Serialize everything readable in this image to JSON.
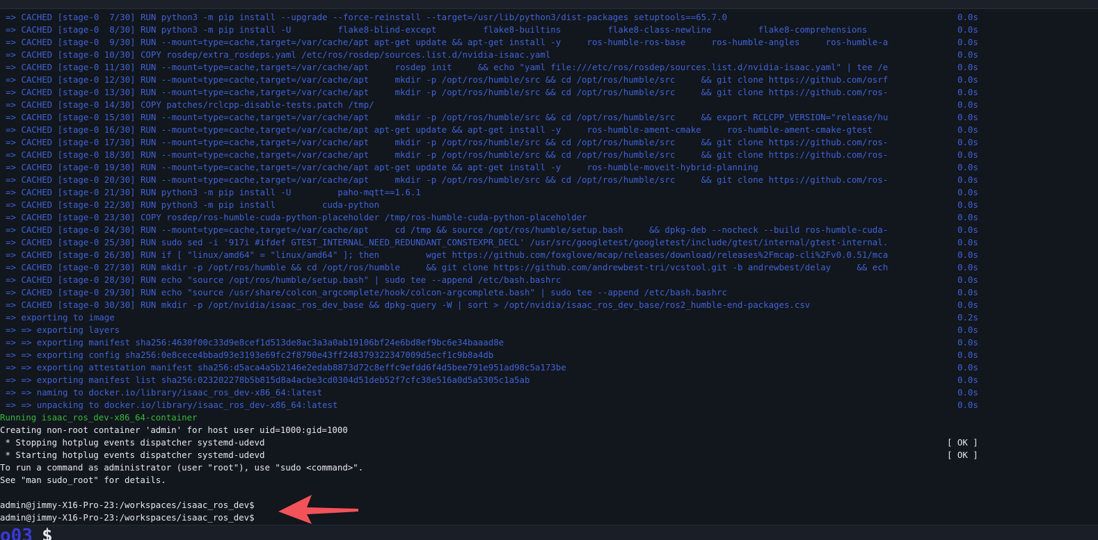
{
  "terminal": {
    "build_steps": [
      {
        "text": "=> CACHED [stage-0  7/30] RUN python3 -m pip install --upgrade --force-reinstall --target=/usr/lib/python3/dist-packages setuptools==65.7.0",
        "time": "0.0s"
      },
      {
        "text": "=> CACHED [stage-0  8/30] RUN python3 -m pip install -U         flake8-blind-except         flake8-builtins         flake8-class-newline         flake8-comprehensions",
        "time": "0.0s"
      },
      {
        "text": "=> CACHED [stage-0  9/30] RUN --mount=type=cache,target=/var/cache/apt apt-get update && apt-get install -y     ros-humble-ros-base     ros-humble-angles     ros-humble-a",
        "time": "0.0s"
      },
      {
        "text": "=> CACHED [stage-0 10/30] COPY rosdep/extra_rosdeps.yaml /etc/ros/rosdep/sources.list.d/nvidia-isaac.yaml",
        "time": "0.0s"
      },
      {
        "text": "=> CACHED [stage-0 11/30] RUN --mount=type=cache,target=/var/cache/apt     rosdep init     && echo \"yaml file:///etc/ros/rosdep/sources.list.d/nvidia-isaac.yaml\" | tee /e",
        "time": "0.0s"
      },
      {
        "text": "=> CACHED [stage-0 12/30] RUN --mount=type=cache,target=/var/cache/apt     mkdir -p /opt/ros/humble/src && cd /opt/ros/humble/src     && git clone https://github.com/osrf",
        "time": "0.0s"
      },
      {
        "text": "=> CACHED [stage-0 13/30] RUN --mount=type=cache,target=/var/cache/apt     mkdir -p /opt/ros/humble/src && cd /opt/ros/humble/src     && git clone https://github.com/ros-",
        "time": "0.0s"
      },
      {
        "text": "=> CACHED [stage-0 14/30] COPY patches/rclcpp-disable-tests.patch /tmp/",
        "time": "0.0s"
      },
      {
        "text": "=> CACHED [stage-0 15/30] RUN --mount=type=cache,target=/var/cache/apt     mkdir -p /opt/ros/humble/src && cd /opt/ros/humble/src     && export RCLCPP_VERSION=\"release/hu",
        "time": "0.0s"
      },
      {
        "text": "=> CACHED [stage-0 16/30] RUN --mount=type=cache,target=/var/cache/apt apt-get update && apt-get install -y     ros-humble-ament-cmake     ros-humble-ament-cmake-gtest",
        "time": "0.0s"
      },
      {
        "text": "=> CACHED [stage-0 17/30] RUN --mount=type=cache,target=/var/cache/apt     mkdir -p /opt/ros/humble/src && cd /opt/ros/humble/src     && git clone https://github.com/ros-",
        "time": "0.0s"
      },
      {
        "text": "=> CACHED [stage-0 18/30] RUN --mount=type=cache,target=/var/cache/apt     mkdir -p /opt/ros/humble/src && cd /opt/ros/humble/src     && git clone https://github.com/ros-",
        "time": "0.0s"
      },
      {
        "text": "=> CACHED [stage-0 19/30] RUN --mount=type=cache,target=/var/cache/apt apt-get update && apt-get install -y     ros-humble-moveit-hybrid-planning",
        "time": "0.0s"
      },
      {
        "text": "=> CACHED [stage-0 20/30] RUN --mount=type=cache,target=/var/cache/apt     mkdir -p /opt/ros/humble/src && cd /opt/ros/humble/src     && git clone https://github.com/ros-",
        "time": "0.0s"
      },
      {
        "text": "=> CACHED [stage-0 21/30] RUN python3 -m pip install -U         paho-mqtt==1.6.1",
        "time": "0.0s"
      },
      {
        "text": "=> CACHED [stage-0 22/30] RUN python3 -m pip install         cuda-python",
        "time": "0.0s"
      },
      {
        "text": "=> CACHED [stage-0 23/30] COPY rosdep/ros-humble-cuda-python-placeholder /tmp/ros-humble-cuda-python-placeholder",
        "time": "0.0s"
      },
      {
        "text": "=> CACHED [stage-0 24/30] RUN --mount=type=cache,target=/var/cache/apt     cd /tmp && source /opt/ros/humble/setup.bash     && dpkg-deb --nocheck --build ros-humble-cuda-",
        "time": "0.0s"
      },
      {
        "text": "=> CACHED [stage-0 25/30] RUN sudo sed -i '917i #ifdef GTEST_INTERNAL_NEED_REDUNDANT_CONSTEXPR_DECL' /usr/src/googletest/googletest/include/gtest/internal/gtest-internal.",
        "time": "0.0s"
      },
      {
        "text": "=> CACHED [stage-0 26/30] RUN if [ \"linux/amd64\" = \"linux/amd64\" ]; then         wget https://github.com/foxglove/mcap/releases/download/releases%2Fmcap-cli%2Fv0.0.51/mca",
        "time": "0.0s"
      },
      {
        "text": "=> CACHED [stage-0 27/30] RUN mkdir -p /opt/ros/humble && cd /opt/ros/humble     && git clone https://github.com/andrewbest-tri/vcstool.git -b andrewbest/delay     && ech",
        "time": "0.0s"
      },
      {
        "text": "=> CACHED [stage-0 28/30] RUN echo \"source /opt/ros/humble/setup.bash\" | sudo tee --append /etc/bash.bashrc",
        "time": "0.0s"
      },
      {
        "text": "=> CACHED [stage-0 29/30] RUN echo \"source /usr/share/colcon_argcomplete/hook/colcon-argcomplete.bash\" | sudo tee --append /etc/bash.bashrc",
        "time": "0.0s"
      },
      {
        "text": "=> CACHED [stage-0 30/30] RUN mkdir -p /opt/nvidia/isaac_ros_dev_base && dpkg-query -W | sort > /opt/nvidia/isaac_ros_dev_base/ros2_humble-end-packages.csv",
        "time": "0.0s"
      },
      {
        "text": "=> exporting to image",
        "time": "0.2s"
      },
      {
        "text": "=> => exporting layers",
        "time": "0.0s"
      },
      {
        "text": "=> => exporting manifest sha256:4630f00c33d9e8cef1d513de8ac3a3a0ab19106bf24e6bd8ef9bc6e34baaad8e",
        "time": "0.0s"
      },
      {
        "text": "=> => exporting config sha256:0e8cece4bbad93e3193e69fc2f8790e43ff248379322347009d5ecf1c9b8a4db",
        "time": "0.0s"
      },
      {
        "text": "=> => exporting attestation manifest sha256:d5aca4a5b2146e2edab8873d72c8effc9efdd6f4d5bee791e951ad98c5a173be",
        "time": "0.0s"
      },
      {
        "text": "=> => exporting manifest list sha256:023202278b5b815d8a4acbe3cd0304d51deb52f7cfc38e516a0d5a5305c1a5ab",
        "time": "0.0s"
      },
      {
        "text": "=> => naming to docker.io/library/isaac_ros_dev-x86_64:latest",
        "time": "0.0s"
      },
      {
        "text": "=> => unpacking to docker.io/library/isaac_ros_dev-x86_64:latest",
        "time": "0.0s"
      }
    ],
    "running_line": "Running isaac_ros_dev-x86_64-container",
    "creating_line": "Creating non-root container 'admin' for host user uid=1000:gid=1000",
    "service_lines": [
      {
        "text": " * Stopping hotplug events dispatcher systemd-udevd",
        "status": "[ OK ]"
      },
      {
        "text": " * Starting hotplug events dispatcher systemd-udevd",
        "status": "[ OK ]"
      }
    ],
    "sudo_hint_1": "To run a command as administrator (user \"root\"), use \"sudo <command>\".",
    "sudo_hint_2": "See \"man sudo_root\" for details.",
    "prompts": [
      "admin@jimmy-X16-Pro-23:/workspaces/isaac_ros_dev$",
      "admin@jimmy-X16-Pro-23:/workspaces/isaac_ros_dev$"
    ],
    "bottom_tab_label": "o03",
    "bottom_prompt_symbol": "$"
  },
  "colors": {
    "build_text": "#3f63d6",
    "running_text": "#35b83a",
    "plain_text": "#e7e9ee",
    "arrow": "#f25358",
    "background": "#12161d"
  },
  "icons": {
    "annotation_arrow": "arrow-left-icon"
  }
}
